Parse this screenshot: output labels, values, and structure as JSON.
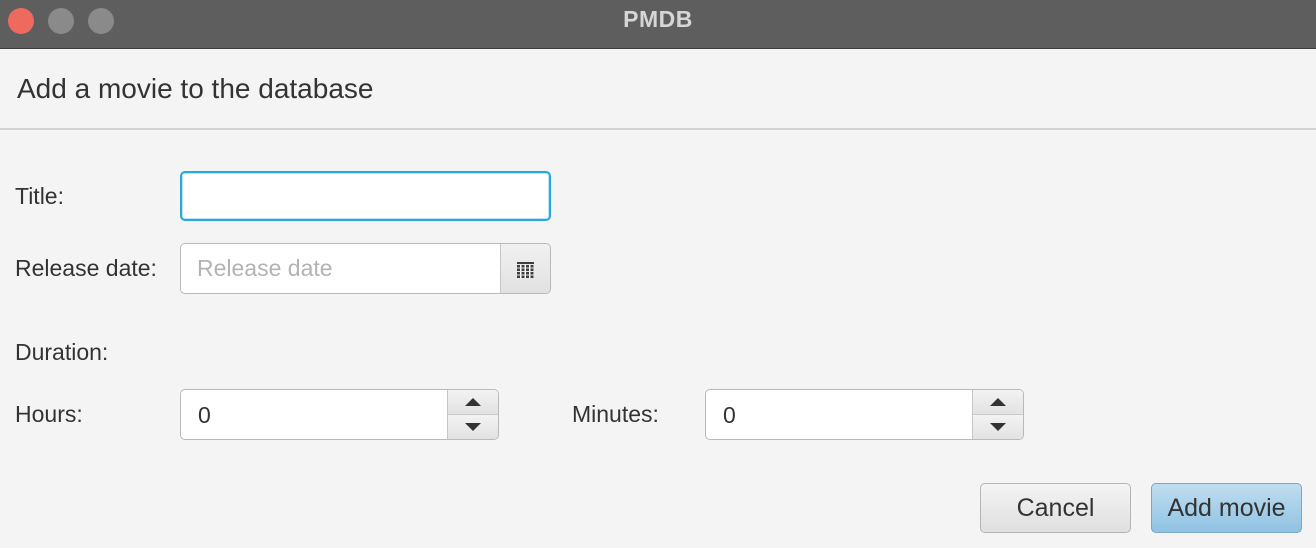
{
  "window": {
    "title": "PMDB"
  },
  "header": {
    "title": "Add a movie to the database"
  },
  "form": {
    "title_label": "Title:",
    "title_value": "",
    "release_date_label": "Release date:",
    "release_date_placeholder": "Release date",
    "duration_label": "Duration:",
    "hours_label": "Hours:",
    "hours_value": "0",
    "minutes_label": "Minutes:",
    "minutes_value": "0"
  },
  "actions": {
    "cancel_label": "Cancel",
    "add_label": "Add movie"
  },
  "icons": {
    "date_picker": "calendar-icon",
    "increment": "arrow-up-icon",
    "decrement": "arrow-down-icon"
  },
  "colors": {
    "close": "#ee6a5e",
    "focus": "#2aa7de",
    "primary_button": "#a8d0ea"
  }
}
